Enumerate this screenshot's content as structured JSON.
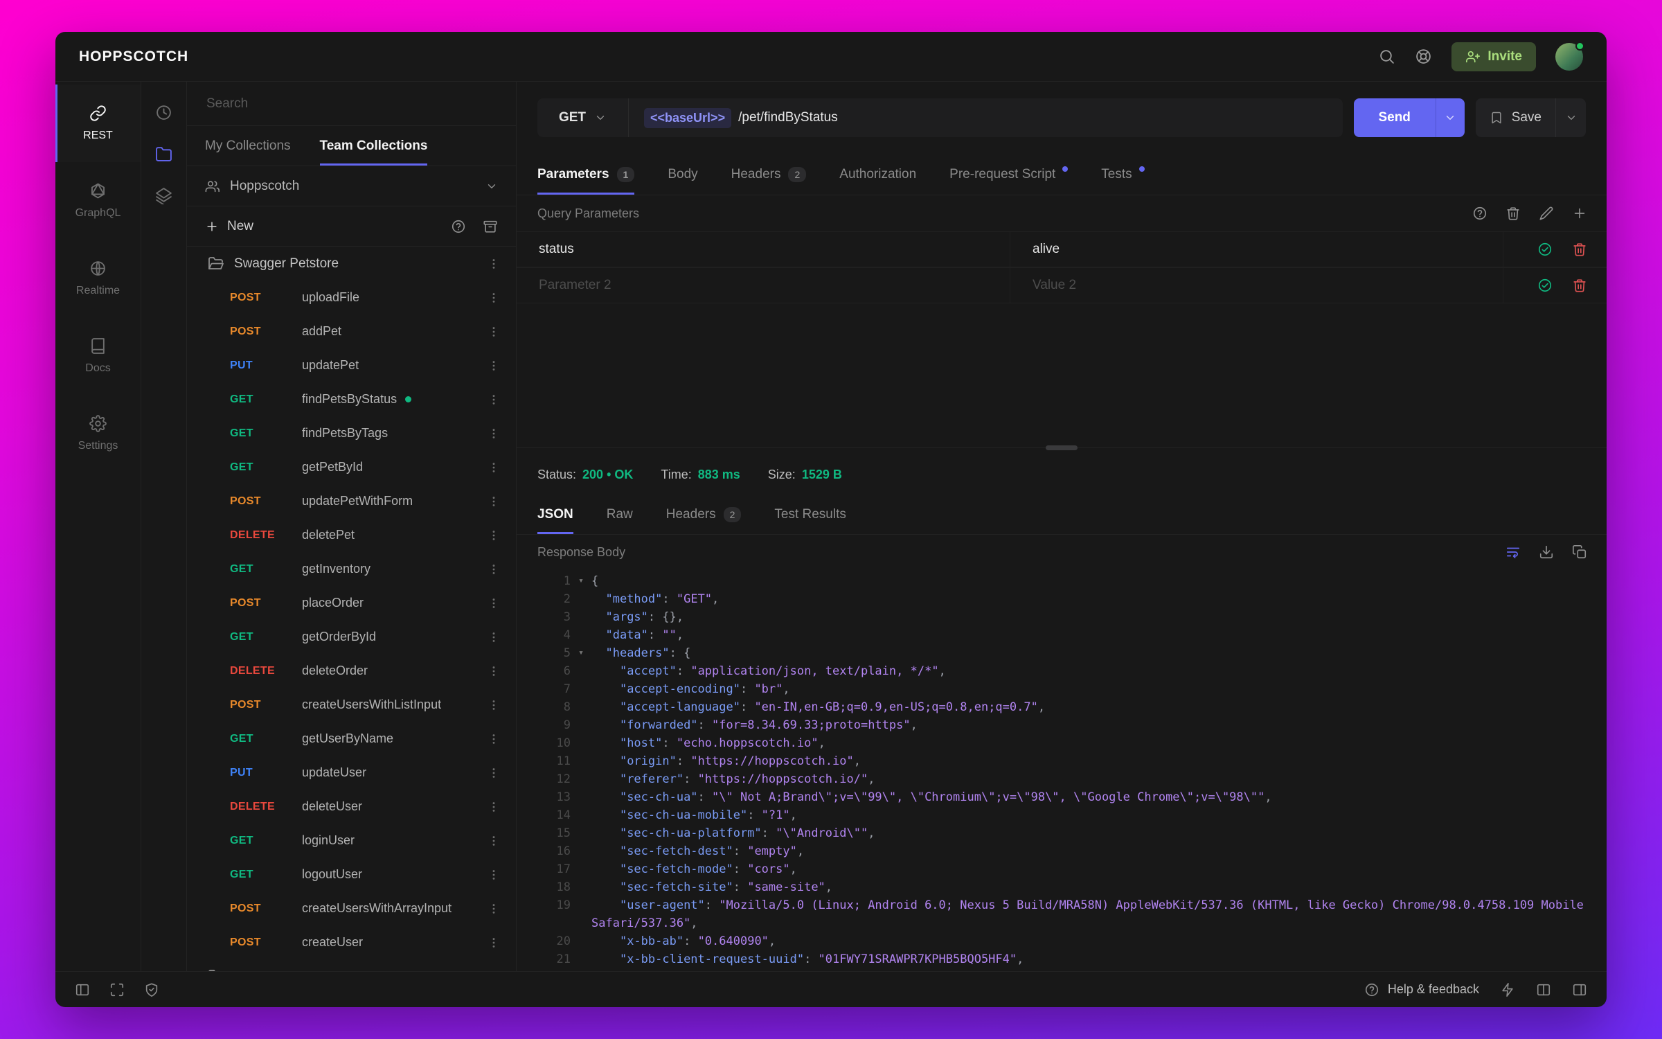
{
  "window": {
    "title": "HOPPSCOTCH",
    "invite_label": "Invite"
  },
  "nav": {
    "items": [
      {
        "id": "rest",
        "label": "REST",
        "icon": "link",
        "active": true
      },
      {
        "id": "graphql",
        "label": "GraphQL",
        "icon": "graphql",
        "active": false
      },
      {
        "id": "realtime",
        "label": "Realtime",
        "icon": "globe",
        "active": false
      },
      {
        "id": "docs",
        "label": "Docs",
        "icon": "book",
        "active": false
      },
      {
        "id": "settings",
        "label": "Settings",
        "icon": "gear",
        "active": false
      }
    ]
  },
  "subnav": {
    "items": [
      {
        "id": "history",
        "icon": "clock",
        "active": false
      },
      {
        "id": "collections",
        "icon": "folder",
        "active": true
      },
      {
        "id": "environments",
        "icon": "layers",
        "active": false
      }
    ]
  },
  "collections": {
    "search_placeholder": "Search",
    "tabs": [
      {
        "label": "My Collections",
        "active": false
      },
      {
        "label": "Team Collections",
        "active": true
      }
    ],
    "team_name": "Hoppscotch",
    "new_label": "New",
    "folder_name": "Swagger Petstore",
    "requests": [
      {
        "method": "POST",
        "name": "uploadFile"
      },
      {
        "method": "POST",
        "name": "addPet"
      },
      {
        "method": "PUT",
        "name": "updatePet"
      },
      {
        "method": "GET",
        "name": "findPetsByStatus",
        "active": true
      },
      {
        "method": "GET",
        "name": "findPetsByTags"
      },
      {
        "method": "GET",
        "name": "getPetById"
      },
      {
        "method": "POST",
        "name": "updatePetWithForm"
      },
      {
        "method": "DELETE",
        "name": "deletePet"
      },
      {
        "method": "GET",
        "name": "getInventory"
      },
      {
        "method": "POST",
        "name": "placeOrder"
      },
      {
        "method": "GET",
        "name": "getOrderById"
      },
      {
        "method": "DELETE",
        "name": "deleteOrder"
      },
      {
        "method": "POST",
        "name": "createUsersWithListInput"
      },
      {
        "method": "GET",
        "name": "getUserByName"
      },
      {
        "method": "PUT",
        "name": "updateUser"
      },
      {
        "method": "DELETE",
        "name": "deleteUser"
      },
      {
        "method": "GET",
        "name": "loginUser"
      },
      {
        "method": "GET",
        "name": "logoutUser"
      },
      {
        "method": "POST",
        "name": "createUsersWithArrayInput"
      },
      {
        "method": "POST",
        "name": "createUser"
      }
    ]
  },
  "request": {
    "method": "GET",
    "url_token": "<<baseUrl>>",
    "url_path": "/pet/findByStatus",
    "send_label": "Send",
    "save_label": "Save",
    "tabs": [
      {
        "label": "Parameters",
        "badge": "1",
        "active": true
      },
      {
        "label": "Body"
      },
      {
        "label": "Headers",
        "badge": "2"
      },
      {
        "label": "Authorization"
      },
      {
        "label": "Pre-request Script",
        "dot": true
      },
      {
        "label": "Tests",
        "dot": true
      }
    ],
    "params_title": "Query Parameters",
    "params": [
      {
        "key": "status",
        "value": "alive"
      },
      {
        "key_placeholder": "Parameter 2",
        "value_placeholder": "Value 2"
      }
    ]
  },
  "response": {
    "status_label": "Status:",
    "status_value": "200 • OK",
    "time_label": "Time:",
    "time_value": "883 ms",
    "size_label": "Size:",
    "size_value": "1529 B",
    "tabs": [
      {
        "label": "JSON",
        "active": true
      },
      {
        "label": "Raw"
      },
      {
        "label": "Headers",
        "badge": "2"
      },
      {
        "label": "Test Results"
      }
    ],
    "body_title": "Response Body",
    "code": {
      "lines": [
        {
          "n": 1,
          "fold": true,
          "open": "{"
        },
        {
          "n": 2,
          "ind": "  ",
          "k": "method",
          "v": "GET",
          "comma": true
        },
        {
          "n": 3,
          "ind": "  ",
          "k": "args",
          "open": "{},"
        },
        {
          "n": 4,
          "ind": "  ",
          "k": "data",
          "v": "",
          "comma": true
        },
        {
          "n": 5,
          "fold": true,
          "ind": "  ",
          "k": "headers",
          "open": "{"
        },
        {
          "n": 6,
          "ind": "    ",
          "k": "accept",
          "v": "application/json, text/plain, */*",
          "comma": true
        },
        {
          "n": 7,
          "ind": "    ",
          "k": "accept-encoding",
          "v": "br",
          "comma": true
        },
        {
          "n": 8,
          "ind": "    ",
          "k": "accept-language",
          "v": "en-IN,en-GB;q=0.9,en-US;q=0.8,en;q=0.7",
          "comma": true
        },
        {
          "n": 9,
          "ind": "    ",
          "k": "forwarded",
          "v": "for=8.34.69.33;proto=https",
          "comma": true
        },
        {
          "n": 10,
          "ind": "    ",
          "k": "host",
          "v": "echo.hoppscotch.io",
          "comma": true
        },
        {
          "n": 11,
          "ind": "    ",
          "k": "origin",
          "v": "https://hoppscotch.io",
          "comma": true
        },
        {
          "n": 12,
          "ind": "    ",
          "k": "referer",
          "v": "https://hoppscotch.io/",
          "comma": true
        },
        {
          "n": 13,
          "ind": "    ",
          "k": "sec-ch-ua",
          "v": "\\\" Not A;Brand\\\";v=\\\"99\\\", \\\"Chromium\\\";v=\\\"98\\\", \\\"Google Chrome\\\";v=\\\"98\\\"",
          "comma": true
        },
        {
          "n": 14,
          "ind": "    ",
          "k": "sec-ch-ua-mobile",
          "v": "?1",
          "comma": true
        },
        {
          "n": 15,
          "ind": "    ",
          "k": "sec-ch-ua-platform",
          "v": "\\\"Android\\\"",
          "comma": true
        },
        {
          "n": 16,
          "ind": "    ",
          "k": "sec-fetch-dest",
          "v": "empty",
          "comma": true
        },
        {
          "n": 17,
          "ind": "    ",
          "k": "sec-fetch-mode",
          "v": "cors",
          "comma": true
        },
        {
          "n": 18,
          "ind": "    ",
          "k": "sec-fetch-site",
          "v": "same-site",
          "comma": true
        },
        {
          "n": 19,
          "ind": "    ",
          "k": "user-agent",
          "v": "Mozilla/5.0 (Linux; Android 6.0; Nexus 5 Build/MRA58N) AppleWebKit/537.36 (KHTML, like Gecko) Chrome/98.0.4758.109 Mobile Safari/537.36",
          "comma": true
        },
        {
          "n": 20,
          "ind": "    ",
          "k": "x-bb-ab",
          "v": "0.640090",
          "comma": true
        },
        {
          "n": 21,
          "ind": "    ",
          "k": "x-bb-client-request-uuid",
          "v": "01FWY71SRAWPR7KPHB5BQO5HF4",
          "comma": true
        }
      ]
    }
  },
  "footer": {
    "help_label": "Help & feedback"
  }
}
